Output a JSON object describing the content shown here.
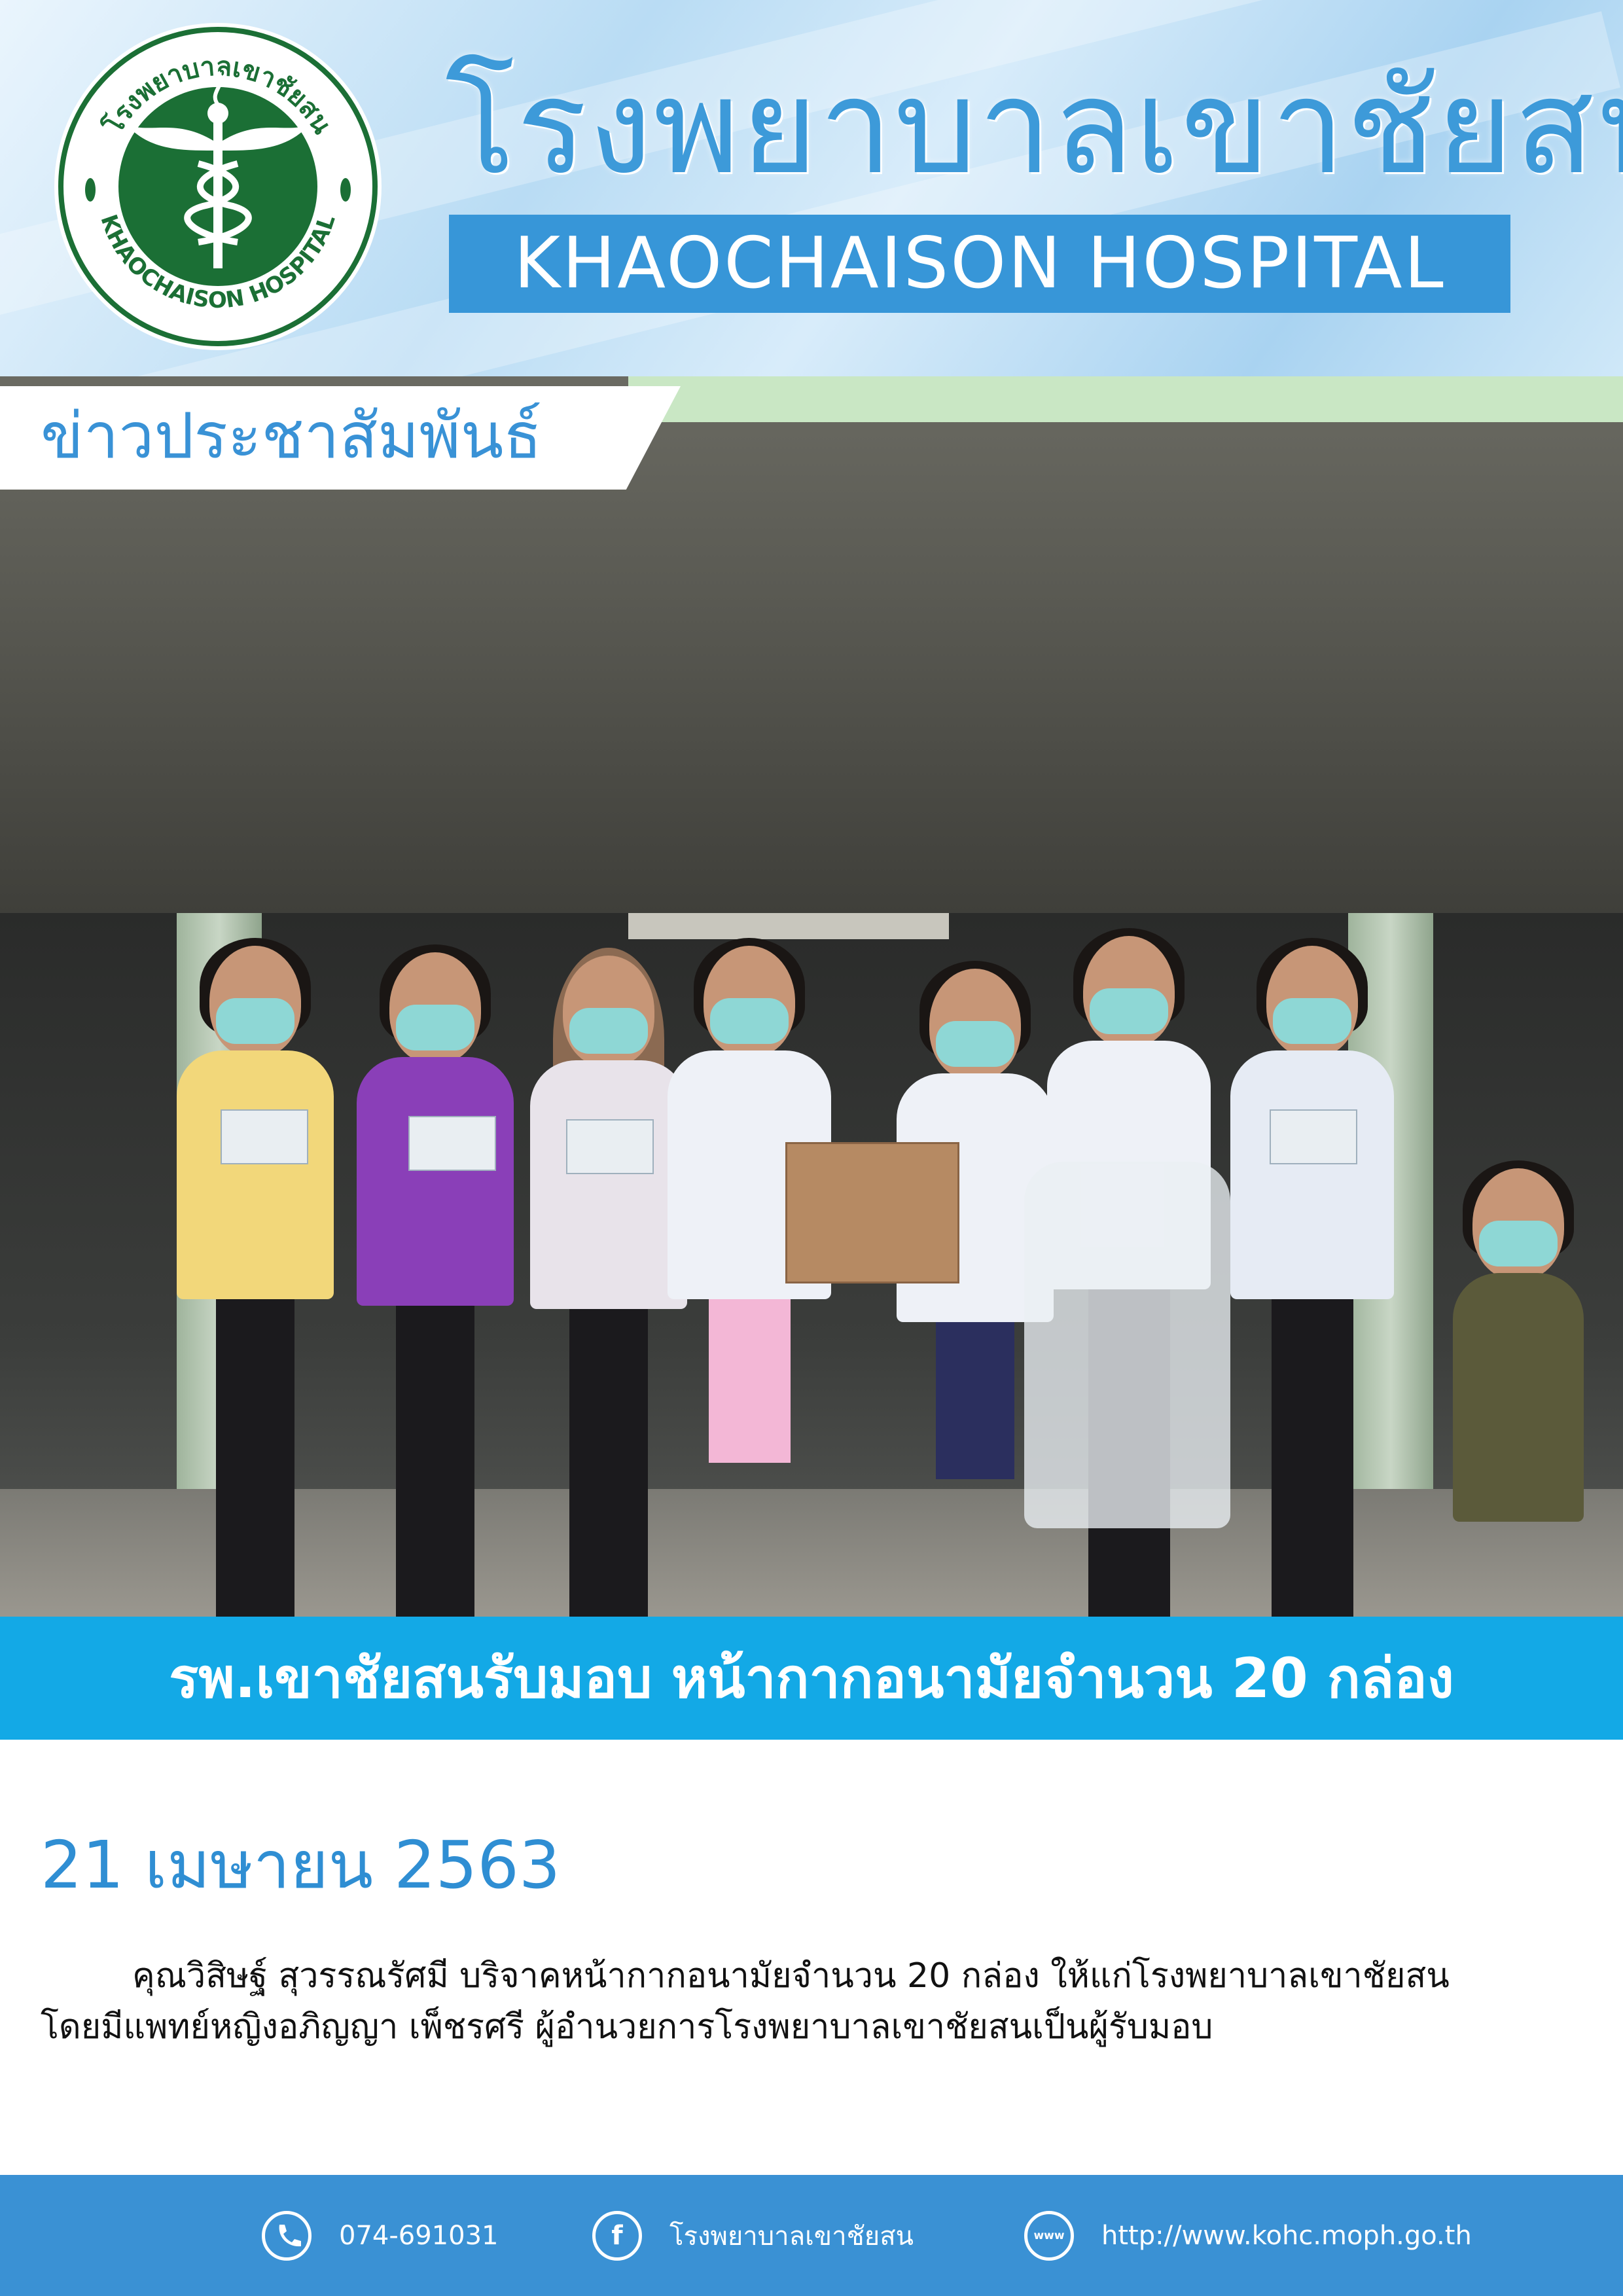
{
  "header": {
    "title_th": "โรงพยาบาลเขาชัยสน",
    "title_en": "KHAOCHAISON HOSPITAL",
    "logo": {
      "ring_text_th": "โรงพยาบาลเขาชัยสน",
      "ring_text_en": "KHAOCHAISON HOSPITAL"
    }
  },
  "section_label": "ข่าวประชาสัมพันธ์",
  "headline": "รพ.เขาชัยสนรับมอบ หน้ากากอนามัยจำนวน 20 กล่อง",
  "article": {
    "date": "21 เมษายน 2563",
    "line1": "คุณวิสิษฐ์ สุวรรณรัศมี บริจาคหน้ากากอนามัยจำนวน 20 กล่อง ให้แก่โรงพยาบาลเขาชัยสน",
    "line2": "โดยมีแพทย์หญิงอภิญญา เพ็ชรศรี ผู้อำนวยการโรงพยาบาลเขาชัยสนเป็นผู้รับมอบ"
  },
  "footer": {
    "phone": "074-691031",
    "facebook": "โรงพยาบาลเขาชัยสน",
    "website": "http://www.kohc.moph.go.th"
  },
  "icons": {
    "phone": "phone-icon",
    "facebook": "facebook-icon",
    "website": "www-globe-icon"
  },
  "colors": {
    "brand_blue": "#3796d8",
    "headline_bar": "#13a9e6",
    "logo_green": "#1b6f35",
    "footer": "#3a91d4"
  }
}
